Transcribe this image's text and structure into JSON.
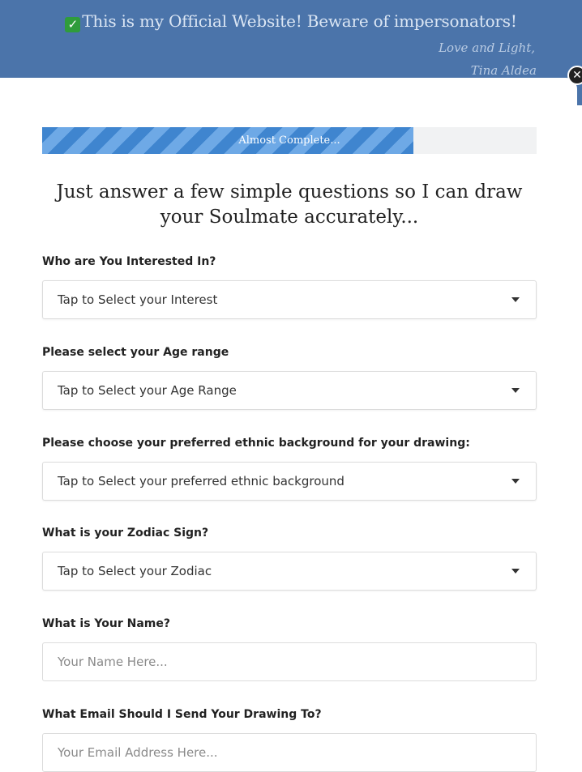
{
  "banner": {
    "check_icon": "✓",
    "title": "This is my Official Website! Beware of impersonators!",
    "signoff_line1": "Love and Light,",
    "signoff_line2": "Tina Aldea",
    "colors": {
      "background": "#4b74aa",
      "text": "#dbe6f4"
    }
  },
  "close_button": {
    "icon": "✕"
  },
  "progress": {
    "label": "Almost Complete...",
    "percent": 75,
    "colors": {
      "fill": "#3f85cf",
      "track": "#f1f2f3"
    }
  },
  "headline": "Just answer a few simple questions so I can draw your Soulmate accurately...",
  "form": {
    "interest": {
      "label": "Who are You Interested In?",
      "selected": "Tap to Select your Interest"
    },
    "age": {
      "label": "Please select your Age range",
      "selected": "Tap to Select your Age Range"
    },
    "ethnic": {
      "label": "Please choose your preferred ethnic background for your drawing:",
      "selected": "Tap to Select your preferred ethnic background"
    },
    "zodiac": {
      "label": "What is your Zodiac Sign?",
      "selected": "Tap to Select your Zodiac"
    },
    "name": {
      "label": "What is Your Name?",
      "placeholder": "Your Name Here..."
    },
    "email": {
      "label": "What Email Should I Send Your Drawing To?",
      "placeholder": "Your Email Address Here..."
    }
  }
}
